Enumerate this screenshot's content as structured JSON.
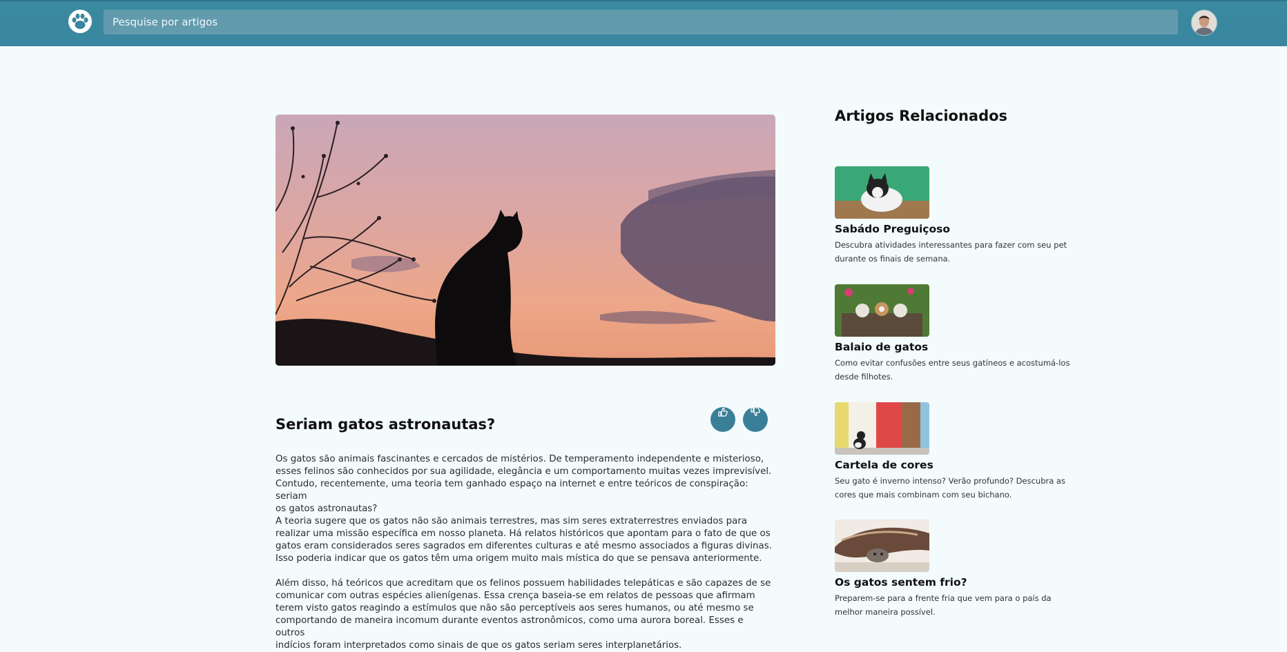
{
  "header": {
    "search_placeholder": "Pesquise por artigos",
    "logo_icon": "paw-icon",
    "avatar": "user-avatar"
  },
  "article": {
    "title": "Seriam gatos astronautas?",
    "paragraphs": [
      "Os gatos são animais fascinantes e cercados de mistérios. De temperamento independente e misterioso,\nesses felinos são conhecidos por sua agilidade, elegância e um comportamento muitas vezes imprevisível.\nContudo, recentemente, uma teoria tem ganhado espaço na internet e entre teóricos de conspiração: seriam\nos gatos astronautas?\nA teoria sugere que os gatos não são animais terrestres, mas sim seres extraterrestres enviados para\nrealizar uma missão específica em nosso planeta. Há relatos históricos que apontam para o fato de que os\ngatos eram considerados seres sagrados em diferentes culturas e até mesmo associados a figuras divinas.\nIsso poderia indicar que os gatos têm uma origem muito mais mística do que se pensava anteriormente.",
      "Além disso, há teóricos que acreditam que os felinos possuem habilidades telepáticas e são capazes de se\ncomunicar com outras espécies alienígenas. Essa crença baseia-se em relatos de pessoas que afirmam\nterem visto gatos reagindo a estímulos que não são perceptíveis aos seres humanos, ou até mesmo se\ncomportando de maneira incomum durante eventos astronômicos, como uma aurora boreal. Esses e outros\nindícios foram interpretados como sinais de que os gatos seriam seres interplanetários."
    ],
    "actions": {
      "like_icon": "thumbs-up-icon",
      "dislike_icon": "thumbs-down-icon"
    }
  },
  "related": {
    "heading": "Artigos Relacionados",
    "items": [
      {
        "title": "Sabádo Preguiçoso",
        "description": "Descubra atividades interessantes para fazer com seu pet durante os finais de semana."
      },
      {
        "title": "Balaio de gatos",
        "description": "Como evitar confusões entre seus gatíneos e acostumá-los desde filhotes."
      },
      {
        "title": "Cartela de cores",
        "description": "Seu gato é inverno intenso? Verão profundo? Descubra as cores que mais combinam com seu bichano."
      },
      {
        "title": "Os gatos sentem frio?",
        "description": "Preparem-se para a frente fria que vem para o país da melhor maneira possível."
      }
    ]
  },
  "colors": {
    "header": "#3a86a0",
    "search": "#629bad",
    "background": "#f3fbfd",
    "action_button": "#3a7f98"
  }
}
